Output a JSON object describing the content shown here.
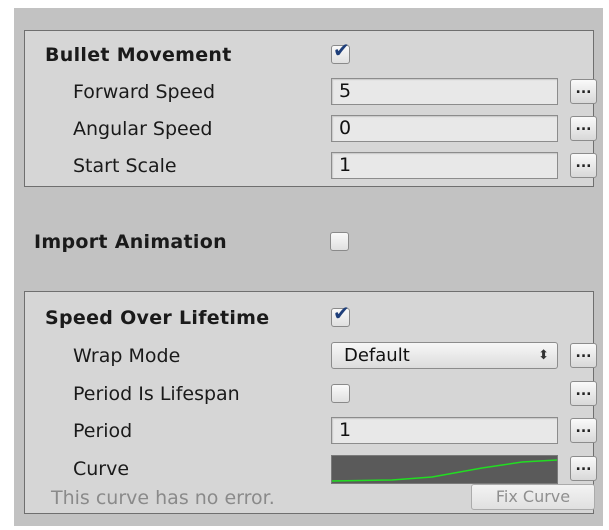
{
  "bullet_movement": {
    "title": "Bullet Movement",
    "enabled": true,
    "fields": [
      {
        "label": "Forward Speed",
        "value": "5"
      },
      {
        "label": "Angular Speed",
        "value": "0"
      },
      {
        "label": "Start Scale",
        "value": "1"
      }
    ]
  },
  "import_animation": {
    "title": "Import Animation",
    "enabled": false
  },
  "speed_over_lifetime": {
    "title": "Speed Over Lifetime",
    "enabled": true,
    "wrap_mode": {
      "label": "Wrap Mode",
      "selected": "Default"
    },
    "period_is_lifespan": {
      "label": "Period Is Lifespan",
      "checked": false
    },
    "period": {
      "label": "Period",
      "value": "1"
    },
    "curve": {
      "label": "Curve"
    },
    "status_text": "This curve has no error.",
    "fix_button": "Fix Curve"
  },
  "more_button_label": "...",
  "check_glyph": "✔",
  "dropdown_arrow_glyph": "⬍",
  "colors": {
    "panel_bg": "#d6d6d6",
    "inspector_bg": "#c2c2c2",
    "check_color": "#1f3f7a",
    "curve_bg": "#5a5a5a",
    "curve_line": "#22dd22"
  }
}
